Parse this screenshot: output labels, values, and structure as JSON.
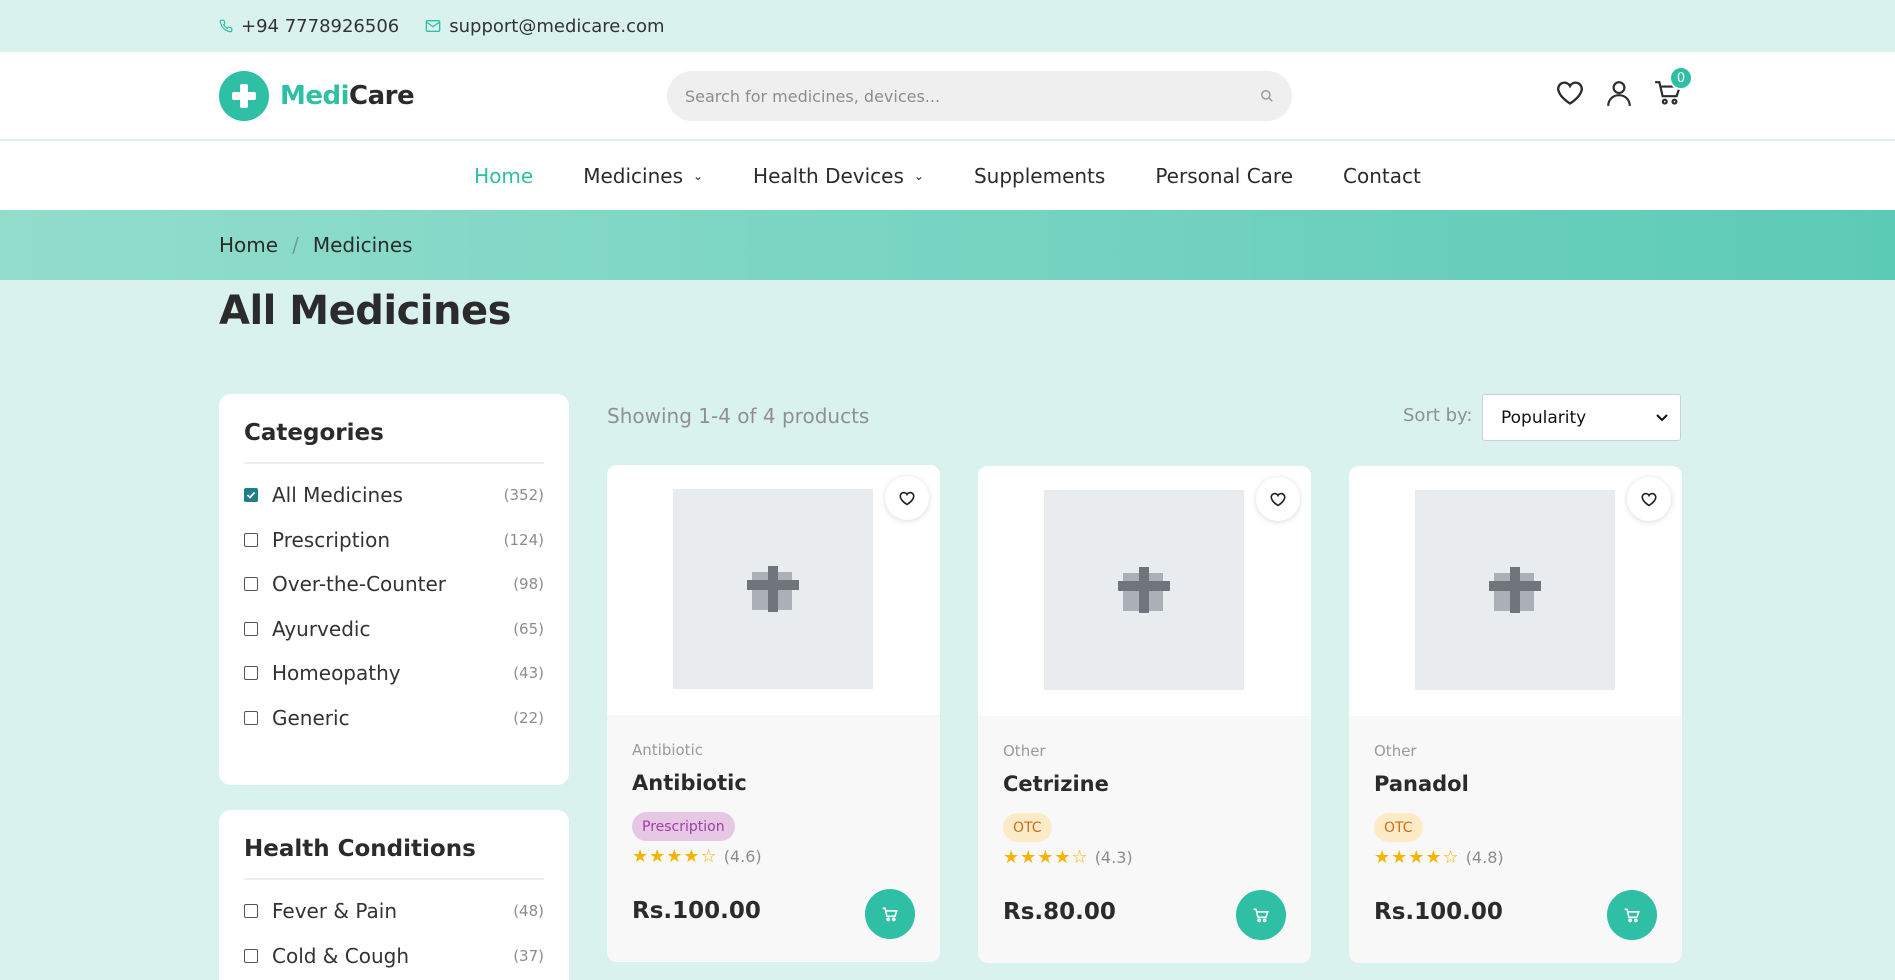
{
  "topbar": {
    "phone": "+94 7778926506",
    "email": "support@medicare.com"
  },
  "header": {
    "logo_part1": "Medi",
    "logo_part2": "Care",
    "search_placeholder": "Search for medicines, devices...",
    "cart_count": "0",
    "icons": [
      "heart-icon",
      "user-icon",
      "cart-icon"
    ]
  },
  "nav": {
    "items": [
      {
        "label": "Home",
        "active": true,
        "dropdown": false
      },
      {
        "label": "Medicines",
        "active": false,
        "dropdown": true
      },
      {
        "label": "Health Devices",
        "active": false,
        "dropdown": true
      },
      {
        "label": "Supplements",
        "active": false,
        "dropdown": false
      },
      {
        "label": "Personal Care",
        "active": false,
        "dropdown": false
      },
      {
        "label": "Contact",
        "active": false,
        "dropdown": false
      }
    ]
  },
  "breadcrumb": {
    "home": "Home",
    "separator": "/",
    "current": "Medicines"
  },
  "page_title": "All Medicines",
  "sidebar": {
    "categories": {
      "title": "Categories",
      "items": [
        {
          "label": "All Medicines",
          "count": "(352)",
          "checked": true
        },
        {
          "label": "Prescription",
          "count": "(124)",
          "checked": false
        },
        {
          "label": "Over-the-Counter",
          "count": "(98)",
          "checked": false
        },
        {
          "label": "Ayurvedic",
          "count": "(65)",
          "checked": false
        },
        {
          "label": "Homeopathy",
          "count": "(43)",
          "checked": false
        },
        {
          "label": "Generic",
          "count": "(22)",
          "checked": false
        }
      ]
    },
    "health_conditions": {
      "title": "Health Conditions",
      "items": [
        {
          "label": "Fever & Pain",
          "count": "(48)",
          "checked": false
        },
        {
          "label": "Cold & Cough",
          "count": "(37)",
          "checked": false
        }
      ]
    }
  },
  "results": {
    "info": "Showing 1-4 of 4 products",
    "sort_label": "Sort by:",
    "sort_value": "Popularity"
  },
  "products": [
    {
      "category": "Antibiotic",
      "name": "Antibiotic",
      "tag": "Prescription",
      "tag_type": "rx",
      "stars": "★★★★☆",
      "rating": "(4.6)",
      "price": "Rs.100.00"
    },
    {
      "category": "Other",
      "name": "Cetrizine",
      "tag": "OTC",
      "tag_type": "otc",
      "stars": "★★★★☆",
      "rating": "(4.3)",
      "price": "Rs.80.00"
    },
    {
      "category": "Other",
      "name": "Panadol",
      "tag": "OTC",
      "tag_type": "otc",
      "stars": "★★★★☆",
      "rating": "(4.8)",
      "price": "Rs.100.00"
    }
  ],
  "colors": {
    "accent": "#2ebfa5",
    "page_bg": "#d9f2ee",
    "rx_bg": "#e6c8e4",
    "otc_bg": "#fdebc8",
    "star": "#f3b600"
  }
}
